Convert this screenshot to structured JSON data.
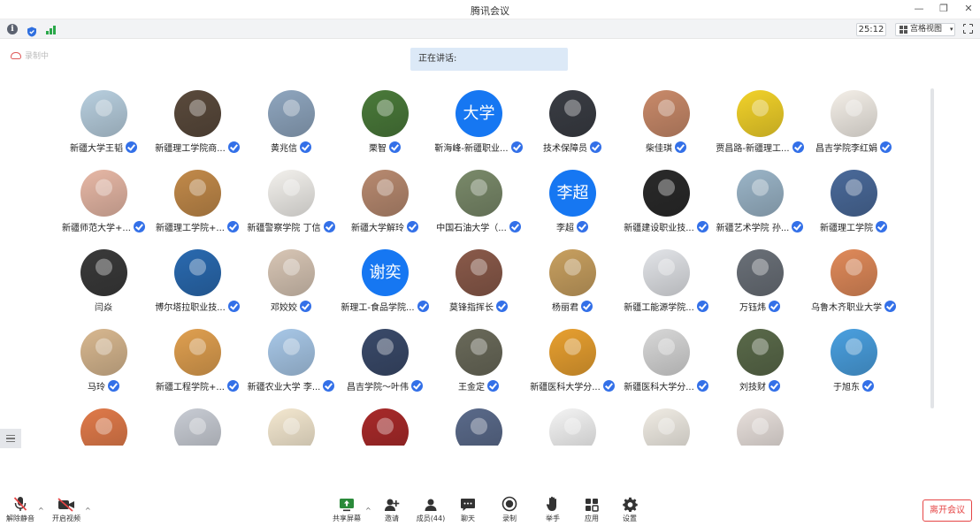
{
  "window": {
    "title": "腾讯会议"
  },
  "toolbar": {
    "timer": "25:12",
    "view_label": "宫格视图"
  },
  "status": {
    "recording": "录制中"
  },
  "speaking": {
    "label": "正在讲话:"
  },
  "participants": [
    {
      "name": "新疆大学王韬",
      "verified": true,
      "avatar": "photo",
      "bg": "#b8cfdf"
    },
    {
      "name": "新疆理工学院商...",
      "verified": true,
      "avatar": "photo",
      "bg": "#5a4a3c"
    },
    {
      "name": "黄兆信",
      "verified": true,
      "avatar": "photo",
      "bg": "#8fa6bf"
    },
    {
      "name": "栗智",
      "verified": true,
      "avatar": "photo",
      "bg": "#4a7a3a"
    },
    {
      "name": "靳海峰-新疆职业...",
      "verified": true,
      "avatar": "text",
      "text": "大学"
    },
    {
      "name": "技术保障员",
      "verified": true,
      "avatar": "photo",
      "bg": "#3a3d44"
    },
    {
      "name": "柴佳琪",
      "verified": true,
      "avatar": "photo",
      "bg": "#c98a6a"
    },
    {
      "name": "贾昌路-新疆理工...",
      "verified": true,
      "avatar": "photo",
      "bg": "#f2d22a"
    },
    {
      "name": "昌吉学院李红娟",
      "verified": true,
      "avatar": "photo",
      "bg": "#f4efe8"
    },
    {
      "name": "新疆师范大学+...",
      "verified": true,
      "avatar": "photo",
      "bg": "#e7b8a6"
    },
    {
      "name": "新疆理工学院+...",
      "verified": true,
      "avatar": "photo",
      "bg": "#c28a4a"
    },
    {
      "name": "新疆警察学院 丁信",
      "verified": true,
      "avatar": "photo",
      "bg": "#f3f1ed"
    },
    {
      "name": "新疆大学解玲",
      "verified": true,
      "avatar": "photo",
      "bg": "#b88a70"
    },
    {
      "name": "中国石油大学（...",
      "verified": true,
      "avatar": "photo",
      "bg": "#7a8a6a"
    },
    {
      "name": "李超",
      "verified": true,
      "avatar": "text",
      "text": "李超"
    },
    {
      "name": "新疆建设职业技...",
      "verified": true,
      "avatar": "photo",
      "bg": "#2a2a2a"
    },
    {
      "name": "新疆艺术学院 孙...",
      "verified": true,
      "avatar": "photo",
      "bg": "#9bb5c8"
    },
    {
      "name": "新疆理工学院",
      "verified": true,
      "avatar": "photo",
      "bg": "#4a6a9a"
    },
    {
      "name": "闫焱",
      "verified": false,
      "avatar": "photo",
      "bg": "#3a3a3a"
    },
    {
      "name": "博尔塔拉职业技...",
      "verified": true,
      "avatar": "photo",
      "bg": "#2a6ab0"
    },
    {
      "name": "邓姣姣",
      "verified": true,
      "avatar": "photo",
      "bg": "#d8c6b5"
    },
    {
      "name": "新理工-食品学院...",
      "verified": true,
      "avatar": "text",
      "text": "谢奕"
    },
    {
      "name": "莫锋指挥长",
      "verified": true,
      "avatar": "photo",
      "bg": "#8a5a4a"
    },
    {
      "name": "杨丽君",
      "verified": true,
      "avatar": "photo",
      "bg": "#c8a060"
    },
    {
      "name": "新疆工能源学院...",
      "verified": true,
      "avatar": "photo",
      "bg": "#e2e4e8"
    },
    {
      "name": "万钰炜",
      "verified": true,
      "avatar": "photo",
      "bg": "#6a7078"
    },
    {
      "name": "乌鲁木齐职业大学",
      "verified": true,
      "avatar": "photo",
      "bg": "#e08a5a"
    },
    {
      "name": "马玲",
      "verified": true,
      "avatar": "photo",
      "bg": "#d8b890"
    },
    {
      "name": "新疆工程学院+...",
      "verified": true,
      "avatar": "photo",
      "bg": "#e0a050"
    },
    {
      "name": "新疆农业大学 李...",
      "verified": true,
      "avatar": "photo",
      "bg": "#a8c8e8"
    },
    {
      "name": "昌吉学院～叶伟",
      "verified": true,
      "avatar": "photo",
      "bg": "#3a4a6a"
    },
    {
      "name": "王金定",
      "verified": true,
      "avatar": "photo",
      "bg": "#6a6a5a"
    },
    {
      "name": "新疆医科大学分...",
      "verified": true,
      "avatar": "photo",
      "bg": "#e8a030"
    },
    {
      "name": "新疆医科大学分...",
      "verified": true,
      "avatar": "photo",
      "bg": "#d8d8d8"
    },
    {
      "name": "刘技财",
      "verified": true,
      "avatar": "photo",
      "bg": "#5a6a4a"
    },
    {
      "name": "于旭东",
      "verified": true,
      "avatar": "photo",
      "bg": "#4aa0e0"
    },
    {
      "name": "",
      "verified": false,
      "avatar": "photo",
      "bg": "#e07a4a"
    },
    {
      "name": "",
      "verified": false,
      "avatar": "photo",
      "bg": "#c8ccd4"
    },
    {
      "name": "",
      "verified": false,
      "avatar": "photo",
      "bg": "#f4e8d0"
    },
    {
      "name": "",
      "verified": false,
      "avatar": "photo",
      "bg": "#a82a2a"
    },
    {
      "name": "",
      "verified": false,
      "avatar": "photo",
      "bg": "#5a6a8a"
    },
    {
      "name": "",
      "verified": false,
      "avatar": "photo",
      "bg": "#f4f4f4"
    },
    {
      "name": "",
      "verified": false,
      "avatar": "photo",
      "bg": "#f0ece4"
    },
    {
      "name": "",
      "verified": false,
      "avatar": "photo",
      "bg": "#e8e0dc"
    }
  ],
  "bottombar": {
    "unmute": "解除静音",
    "start_video": "开启视频",
    "share_screen": "共享屏幕",
    "invite": "邀请",
    "members": "成员(44)",
    "chat": "聊天",
    "record": "录制",
    "raise_hand": "举手",
    "apps": "应用",
    "settings": "设置",
    "leave": "离开会议"
  },
  "colors": {
    "accent": "#1677f2",
    "verify": "#3370e8",
    "leave": "#e54545"
  }
}
